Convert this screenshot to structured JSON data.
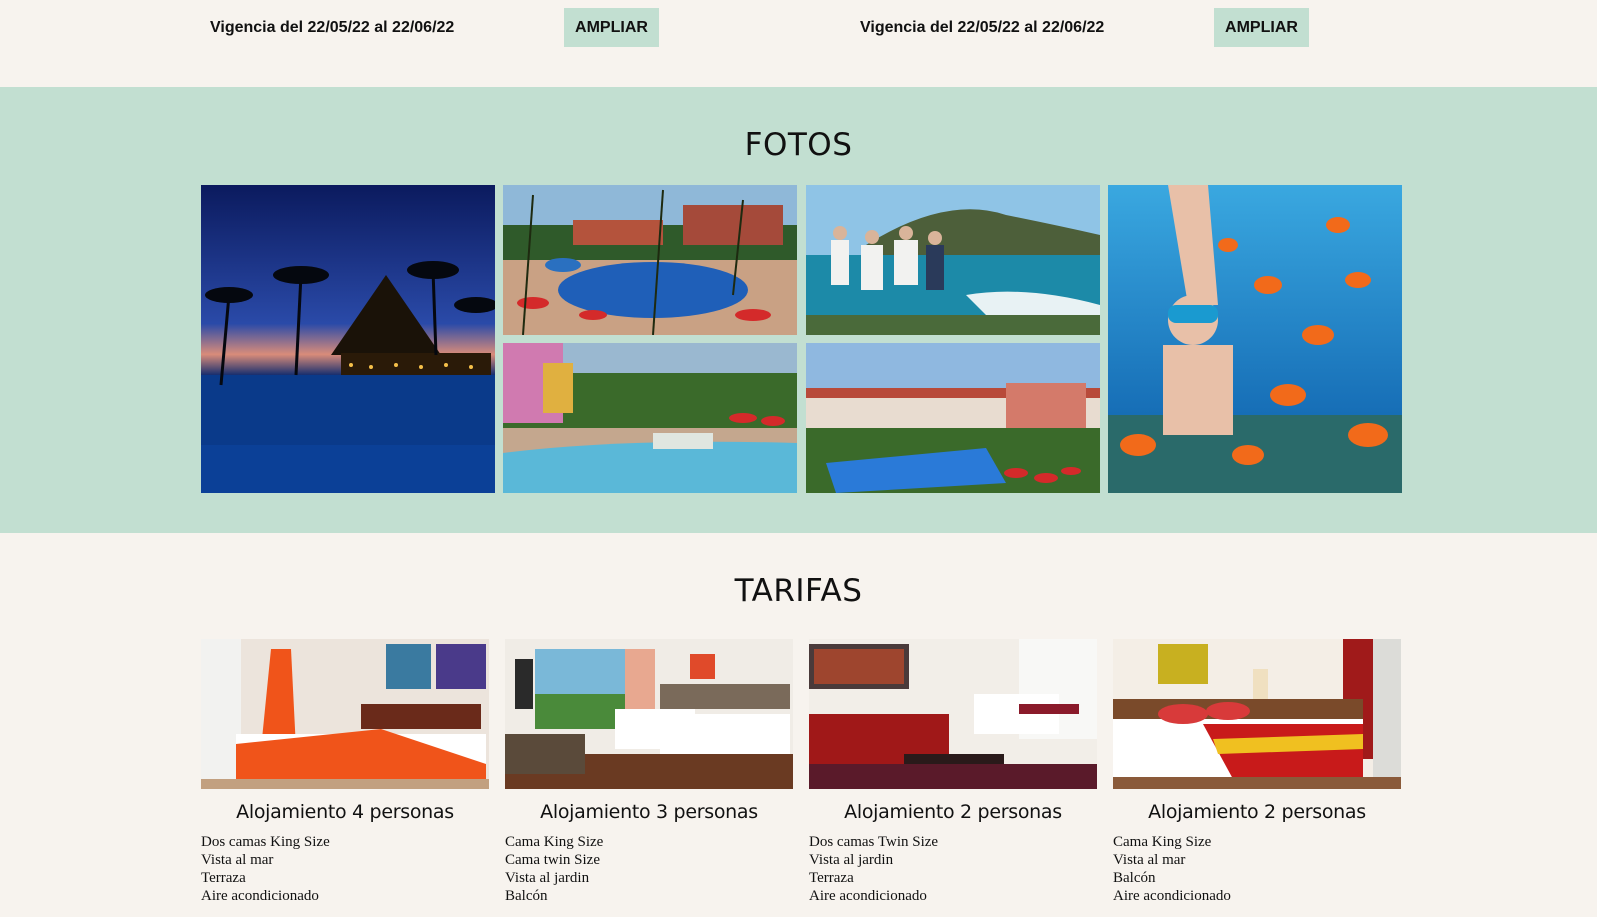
{
  "promos": [
    {
      "validity": "Vigencia del 22/05/22 al 22/06/22",
      "button": "AMPLIAR"
    },
    {
      "validity": "Vigencia del 22/05/22 al 22/06/22",
      "button": "AMPLIAR"
    }
  ],
  "fotos": {
    "title": "FOTOS"
  },
  "tarifas": {
    "title": "TARIFAS",
    "rooms": [
      {
        "name": "Alojamiento 4 personas",
        "features": [
          "Dos camas King Size",
          "Vista al mar",
          "Terraza",
          "Aire acondicionado"
        ]
      },
      {
        "name": "Alojamiento 3 personas",
        "features": [
          "Cama King Size",
          "Cama twin Size",
          "Vista al jardin",
          "Balcón"
        ]
      },
      {
        "name": "Alojamiento 2 personas",
        "features": [
          "Dos camas Twin Size",
          "Vista al jardin",
          "Terraza",
          "Aire acondicionado"
        ]
      },
      {
        "name": "Alojamiento 2 personas",
        "features": [
          "Cama King Size",
          "Vista al mar",
          "Balcón",
          "Aire acondicionado"
        ]
      }
    ]
  },
  "colors": {
    "page_bg": "#f7f3ee",
    "accent_mint": "#c2dfd1",
    "text": "#111111"
  }
}
